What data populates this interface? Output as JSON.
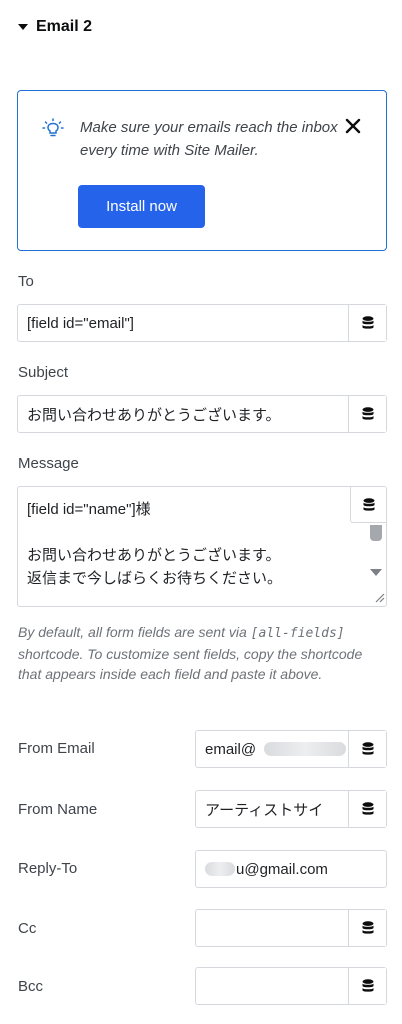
{
  "section": {
    "title": "Email 2"
  },
  "notice": {
    "text": "Make sure your emails reach the inbox every time with Site Mailer.",
    "install_label": "Install now"
  },
  "to": {
    "label": "To",
    "value": "[field id=\"email\"]"
  },
  "subject": {
    "label": "Subject",
    "value": "お問い合わせありがとうございます。"
  },
  "message": {
    "label": "Message",
    "lines": [
      "[field id=\"name\"]様",
      "",
      "お問い合わせありがとうございます。",
      "返信まで今しばらくお待ちください。"
    ]
  },
  "help": {
    "prefix": "By default, all form fields are sent via ",
    "code": "[all-fields]",
    "suffix": " shortcode. To customize sent fields, copy the shortcode that appears inside each field and paste it above."
  },
  "from_email": {
    "label": "From Email",
    "value": "email@"
  },
  "from_name": {
    "label": "From Name",
    "value": "アーティストサイ"
  },
  "reply_to": {
    "label": "Reply-To",
    "value": "u@gmail.com"
  },
  "cc": {
    "label": "Cc",
    "value": ""
  },
  "bcc": {
    "label": "Bcc",
    "value": ""
  },
  "colors": {
    "accent": "#2563eb",
    "notice_border": "#2271d4",
    "text": "#3f444b",
    "border": "#d5d8dc"
  },
  "icons": [
    "caret-down-icon",
    "lightbulb-icon",
    "close-icon",
    "database-icon",
    "scroll-down-icon",
    "resize-handle-icon"
  ]
}
